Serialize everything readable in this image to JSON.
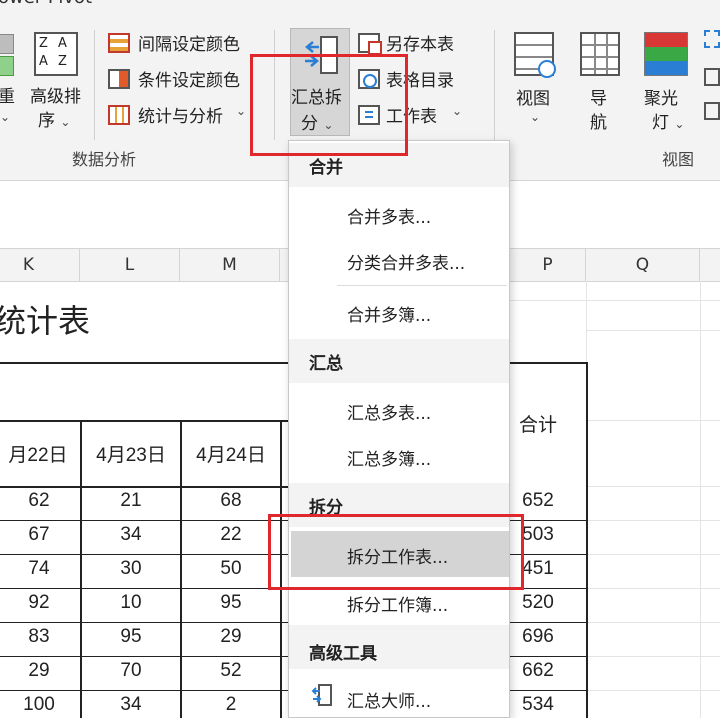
{
  "app_title_partial": "ower Pivot",
  "ribbon": {
    "group_sort": {
      "reorder_partial": "重",
      "advanced_sort_line1": "高级排",
      "advanced_sort_line2": "序"
    },
    "group_data_analysis": {
      "label": "数据分析",
      "interval_color": "间隔设定颜色",
      "conditional_color": "条件设定颜色",
      "stats_analysis": "统计与分析"
    },
    "summary_split": {
      "line1": "汇总拆",
      "line2": "分"
    },
    "save_as_table": "另存本表",
    "table_directory": "表格目录",
    "worksheet": "工作表",
    "group_view": {
      "label": "视图",
      "view": "视图",
      "nav_line1": "导",
      "nav_line2": "航",
      "spotlight_line1": "聚光",
      "spotlight_line2": "灯"
    }
  },
  "sheet": {
    "columns": [
      "K",
      "L",
      "M",
      "P",
      "Q"
    ],
    "title_partial": "统计表",
    "headers": [
      "月22日",
      "4月23日",
      "4月24日",
      "合计"
    ],
    "rows": [
      [
        "62",
        "21",
        "68",
        "652"
      ],
      [
        "67",
        "34",
        "22",
        "503"
      ],
      [
        "74",
        "30",
        "50",
        "451"
      ],
      [
        "92",
        "10",
        "95",
        "520"
      ],
      [
        "83",
        "95",
        "29",
        "696"
      ],
      [
        "29",
        "70",
        "52",
        "662"
      ],
      [
        "100",
        "34",
        "2",
        "534"
      ]
    ]
  },
  "menu": {
    "sections": [
      {
        "title": "合并",
        "items": [
          "合并多表...",
          "分类合并多表...",
          "合并多簿..."
        ]
      },
      {
        "title": "汇总",
        "items": [
          "汇总多表...",
          "汇总多簿..."
        ]
      },
      {
        "title": "拆分",
        "items": [
          "拆分工作表...",
          "拆分工作簿..."
        ]
      },
      {
        "title": "高级工具",
        "items": [
          "汇总大师..."
        ]
      }
    ]
  },
  "colors": {
    "highlight_red": "#e0282c",
    "ribbon_bg": "#f3f3f3",
    "menu_hover": "#d4d4d4"
  }
}
